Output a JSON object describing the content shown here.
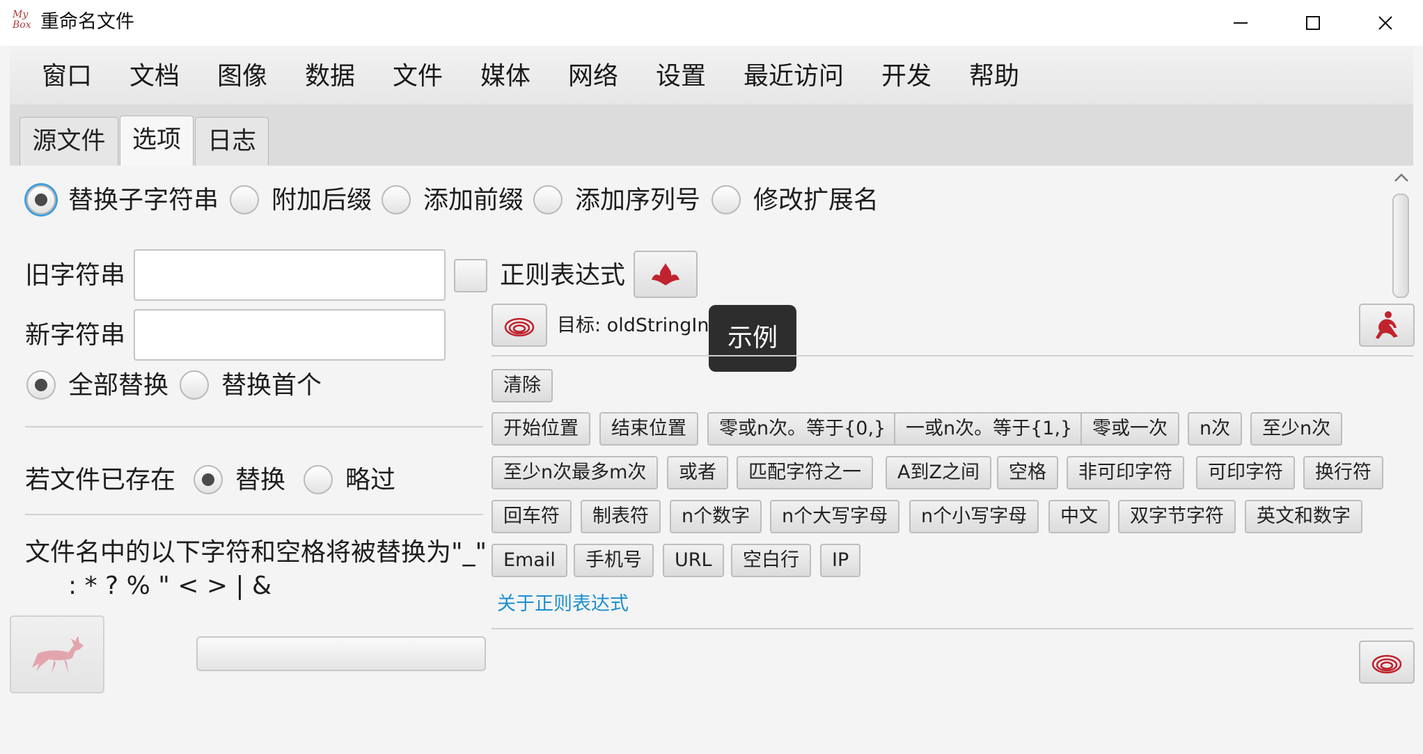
{
  "window": {
    "title": "重命名文件",
    "logo_text": "My Box"
  },
  "menubar": {
    "items": [
      "窗口",
      "文档",
      "图像",
      "数据",
      "文件",
      "媒体",
      "网络",
      "设置",
      "最近访问",
      "开发",
      "帮助"
    ]
  },
  "tabs": {
    "items": [
      "源文件",
      "选项",
      "日志"
    ],
    "active": "选项"
  },
  "rename_mode": {
    "options": [
      "替换子字符串",
      "附加后缀",
      "添加前缀",
      "添加序列号",
      "修改扩展名"
    ],
    "selected": "替换子字符串"
  },
  "replace": {
    "old_label": "旧字符串",
    "old_value": "",
    "new_label": "新字符串",
    "new_value": "",
    "regex_label": "正则表达式",
    "regex_checked": false,
    "scope_options": [
      "全部替换",
      "替换首个"
    ],
    "scope_selected": "全部替换"
  },
  "file_exists": {
    "label": "若文件已存在",
    "options": [
      "替换",
      "略过"
    ],
    "selected": "替换"
  },
  "note": {
    "line1": "文件名中的以下字符和空格将被替换为\"_\"",
    "line2": ": * ? % \" < > | &"
  },
  "regex_panel": {
    "target_label": "目标: oldStringInput",
    "tooltip": "示例",
    "clear_button": "清除",
    "rows": [
      [
        "开始位置",
        "结束位置",
        "零或n次。等于{0,}",
        "一或n次。等于{1,}",
        "零或一次",
        "n次",
        "至少n次"
      ],
      [
        "至少n次最多m次",
        "或者",
        "匹配字符之一",
        "A到Z之间",
        "空格",
        "非可印字符",
        "可印字符",
        "换行符"
      ],
      [
        "回车符",
        "制表符",
        "n个数字",
        "n个大写字母",
        "n个小写字母",
        "中文",
        "双字节字符",
        "英文和数字"
      ],
      [
        "Email",
        "手机号",
        "URL",
        "空白行",
        "IP"
      ]
    ],
    "about_link": "关于正则表达式"
  },
  "colors": {
    "accent_red": "#c0232e",
    "link_blue": "#1e8fce",
    "focus_ring": "#3f9fdc",
    "tooltip_bg": "#2d2d2d"
  },
  "icons": {
    "minimize": "minimize-icon",
    "maximize": "maximize-icon",
    "close": "close-icon",
    "regex_example": "flame-icon",
    "target": "spiral-icon",
    "panel_corner": "figure-icon",
    "start": "deer-icon"
  }
}
